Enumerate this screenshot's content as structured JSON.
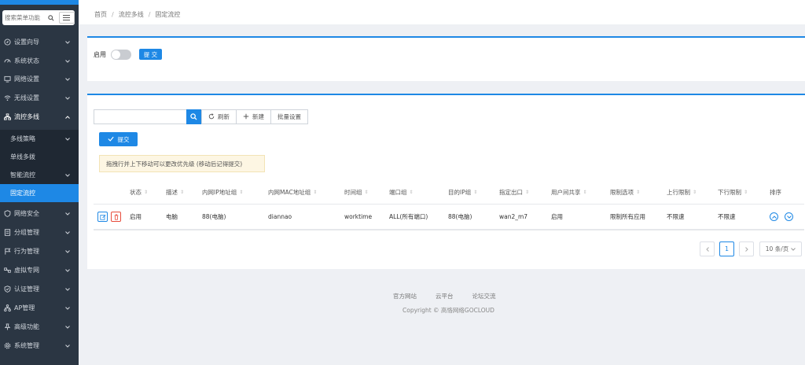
{
  "sidebar": {
    "search_placeholder": "搜索菜单功能",
    "items": [
      {
        "label": "设置向导",
        "icon": "compass-icon"
      },
      {
        "label": "系统状态",
        "icon": "dashboard-icon"
      },
      {
        "label": "网络设置",
        "icon": "monitor-icon"
      },
      {
        "label": "无线设置",
        "icon": "wifi-icon"
      },
      {
        "label": "流控多线",
        "icon": "network-icon"
      },
      {
        "label": "网络安全",
        "icon": "shield-icon"
      },
      {
        "label": "分组管理",
        "icon": "list-icon"
      },
      {
        "label": "行为管理",
        "icon": "flag-icon"
      },
      {
        "label": "虚拟专网",
        "icon": "vpn-icon"
      },
      {
        "label": "认证管理",
        "icon": "shield-check-icon"
      },
      {
        "label": "AP管理",
        "icon": "sitemap-icon"
      },
      {
        "label": "高级功能",
        "icon": "pin-icon"
      },
      {
        "label": "系统管理",
        "icon": "gear-icon"
      }
    ],
    "subitems": [
      {
        "label": "多线策略"
      },
      {
        "label": "单线多拨"
      },
      {
        "label": "智能流控"
      },
      {
        "label": "固定流控"
      }
    ]
  },
  "breadcrumb": {
    "home": "首页",
    "parent": "流控多线",
    "current": "固定流控"
  },
  "panel1": {
    "enable_label": "启用",
    "submit_label": "提 交"
  },
  "toolbar": {
    "refresh_label": "刷新",
    "new_label": "新建",
    "batch_label": "批量设置",
    "submit_label": "提交"
  },
  "notice": "拖拽行并上下移动可以更改优先级 (移动后记得提交)",
  "table": {
    "headers": [
      "状态",
      "描述",
      "内网IP地址组",
      "内网MAC地址组",
      "时间组",
      "端口组",
      "目的IP组",
      "指定出口",
      "用户间共享",
      "限制选项",
      "上行限制",
      "下行限制",
      "排序"
    ],
    "rows": [
      [
        "启用",
        "电脑",
        "88(电脑)",
        "diannao",
        "worktime",
        "ALL(所有端口)",
        "88(电脑)",
        "wan2_m7",
        "启用",
        "限制所有应用",
        "不限速",
        "不限速"
      ]
    ]
  },
  "pagination": {
    "current": "1",
    "page_size": "10 条/页"
  },
  "footer": {
    "links": [
      "官方网站",
      "云平台",
      "论坛交流"
    ],
    "copyright": "Copyright © 高恪网络GOCLOUD"
  },
  "colors": {
    "accent": "#1e88e5",
    "sidebar": "#2b3643",
    "danger": "#e74c3c"
  }
}
